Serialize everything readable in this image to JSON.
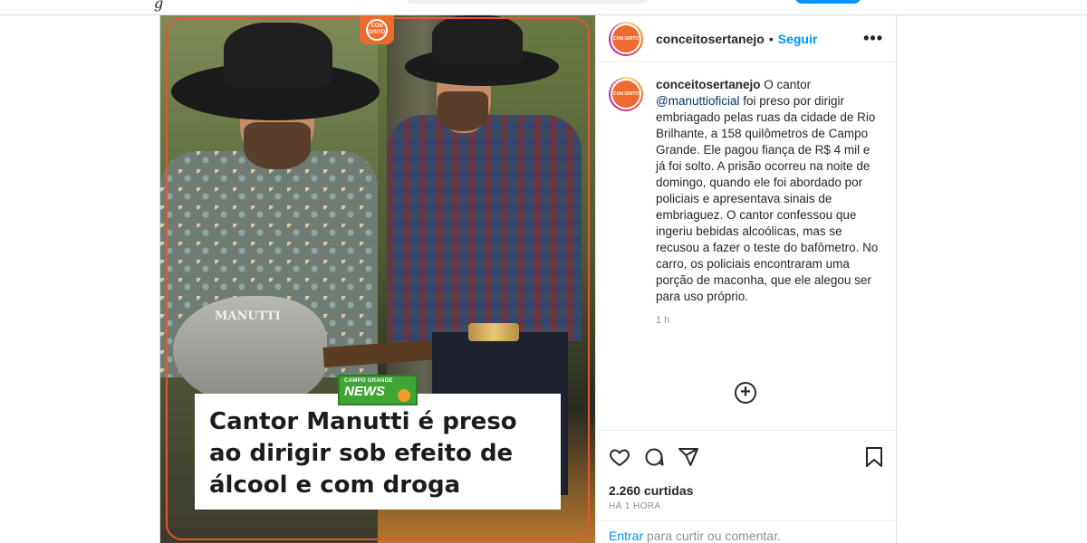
{
  "post": {
    "username": "conceitosertanejo",
    "separator": "•",
    "follow_label": "Seguir",
    "more_label": "•••",
    "avatar_text": "CON GRITO",
    "media": {
      "badge_text": "CON GRITO",
      "guitar_label": "MANUTTI",
      "news_logo_small": "CAMPO GRANDE",
      "news_logo_big": "NEWS",
      "headline": "Cantor Manutti é preso ao dirigir sob efeito de álcool e com droga"
    },
    "caption": {
      "user": "conceitosertanejo",
      "text_before": " O cantor ",
      "mention": "@manuttioficial",
      "text_after": " foi preso por dirigir embriagado pelas ruas da cidade de Rio Brilhante, a 158 quilômetros de Campo Grande. Ele pagou fiança de R$ 4 mil e já foi solto. A prisão ocorreu na noite de domingo, quando ele foi abordado por policiais e apresentava sinais de embriaguez. O cantor confessou que ingeriu bebidas alcoólicas, mas se recusou a fazer o teste do bafômetro. No carro, os policiais encontraram uma porção de maconha, que ele alegou ser para uso próprio.",
      "timestamp": "1 h"
    },
    "add_comment_icon": "plus-circle-icon",
    "actions": {
      "like_icon": "heart-icon",
      "comment_icon": "comment-icon",
      "share_icon": "share-icon",
      "save_icon": "bookmark-icon"
    },
    "likes": "2.260 curtidas",
    "time_ago": "HÁ 1 HORA",
    "login": {
      "enter_label": "Entrar",
      "rest": " para curtir ou comentar."
    }
  },
  "colors": {
    "link_blue": "#0095f6",
    "mention_blue": "#00376b",
    "brand_orange": "#ef6a2f",
    "news_green": "#3fa535"
  }
}
